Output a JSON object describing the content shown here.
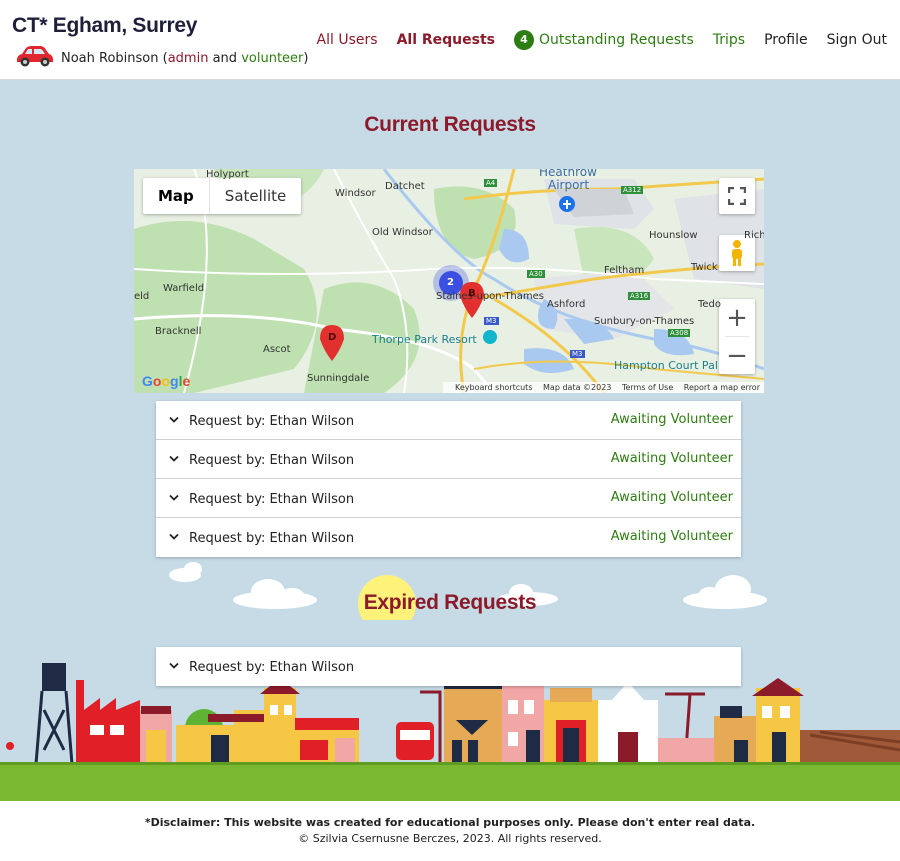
{
  "header": {
    "brand": "CT* Egham, Surrey",
    "user_name": "Noah Robinson",
    "paren_open": "(",
    "role_admin": "admin",
    "role_and": "and",
    "role_volunteer": "volunteer",
    "paren_close": ")"
  },
  "nav": {
    "all_users": "All Users",
    "all_requests": "All Requests",
    "outstanding_count": "4",
    "outstanding": "Outstanding Requests",
    "trips": "Trips",
    "profile": "Profile",
    "sign_out": "Sign Out"
  },
  "current": {
    "title": "Current Requests"
  },
  "map": {
    "type_map": "Map",
    "type_satellite": "Satellite",
    "cluster_count": "2",
    "marker_b": "B",
    "marker_d": "D",
    "labels": {
      "holyport": "Holyport",
      "windsor": "Windsor",
      "datchet": "Datchet",
      "heathrow": "Heathrow",
      "airport": "Airport",
      "hounslow": "Hounslow",
      "richmond": "Rich",
      "old_windsor": "Old Windsor",
      "feltham": "Feltham",
      "twick": "Twick",
      "warfield": "Warfield",
      "staines": "Staines-upon-Thames",
      "ashford": "Ashford",
      "sunbury": "Sunbury-on-Thames",
      "tedd": "Tedo",
      "eld": "eld",
      "bracknell": "Bracknell",
      "ascot": "Ascot",
      "thorpe": "Thorpe Park Resort",
      "hampton": "Hampton Court Pal",
      "sunningdale": "Sunningdale",
      "a4": "A4",
      "a312": "A312",
      "a30": "A30",
      "a316": "A316",
      "a308": "A308",
      "m3a": "M3",
      "m3b": "M3"
    },
    "attribution": {
      "shortcuts": "Keyboard shortcuts",
      "data": "Map data ©2023",
      "terms": "Terms of Use",
      "report": "Report a map error"
    },
    "google": "Google"
  },
  "current_requests": [
    {
      "by": "Request by: Ethan Wilson",
      "status": "Awaiting Volunteer"
    },
    {
      "by": "Request by: Ethan Wilson",
      "status": "Awaiting Volunteer"
    },
    {
      "by": "Request by: Ethan Wilson",
      "status": "Awaiting Volunteer"
    },
    {
      "by": "Request by: Ethan Wilson",
      "status": "Awaiting Volunteer"
    }
  ],
  "expired": {
    "title": "Expired Requests",
    "requests": [
      {
        "by": "Request by: Ethan Wilson"
      }
    ]
  },
  "footer": {
    "disclaimer": "*Disclaimer: This website was created for educational purposes only. Please don't enter real data.",
    "copyright": "© Szilvia Csernusne Berczes, 2023. All rights reserved."
  },
  "colors": {
    "brand_red": "#8b1a2b",
    "accent_green": "#2e7d12",
    "sky": "#c6dbe6",
    "grass": "#7bb832"
  }
}
